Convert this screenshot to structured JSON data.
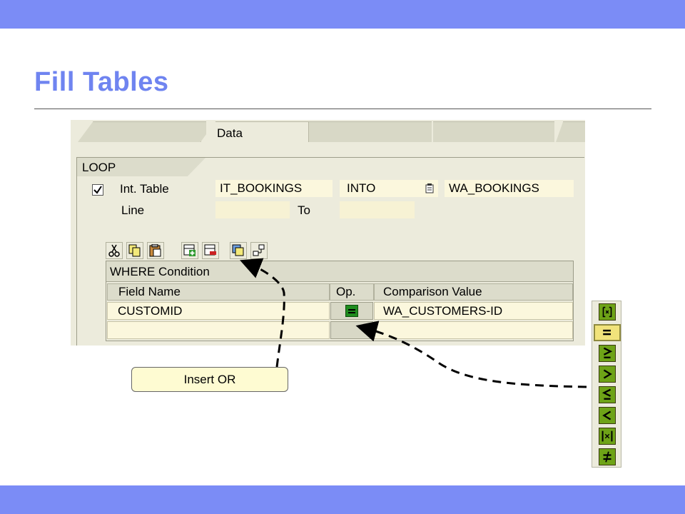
{
  "slide": {
    "title": "Fill Tables",
    "band_color": "#7b8cf6",
    "title_color": "#6f84f0"
  },
  "tabs": [
    {
      "label": ""
    },
    {
      "label": "Data",
      "active": true
    },
    {
      "label": ""
    },
    {
      "label": ""
    },
    {
      "label": ""
    }
  ],
  "loop": {
    "group_label": "LOOP",
    "checked": true,
    "int_table_label": "Int. Table",
    "int_table_value": "IT_BOOKINGS",
    "into_label": "INTO",
    "into_value": "WA_BOOKINGS",
    "line_label": "Line",
    "line_value": "",
    "to_label": "To",
    "to_value": ""
  },
  "toolbar": {
    "icons": [
      "scissors-icon",
      "copy-icon",
      "paste-icon",
      "insert-row-icon",
      "delete-row-icon",
      "insert-or-icon",
      "hierarchy-icon"
    ]
  },
  "where": {
    "title": "WHERE Condition",
    "columns": [
      "Field Name",
      "Op.",
      "Comparison Value"
    ],
    "rows": [
      {
        "field": "CUSTOMID",
        "op": "equals",
        "value": "WA_CUSTOMERS-ID"
      },
      {
        "field": "",
        "op": "",
        "value": ""
      }
    ]
  },
  "callout": {
    "text": "Insert OR"
  },
  "palette": {
    "operators": [
      "between",
      "equals",
      "greater-equal",
      "greater",
      "less-equal",
      "less",
      "not-between",
      "not-equal"
    ],
    "selected": "equals"
  }
}
